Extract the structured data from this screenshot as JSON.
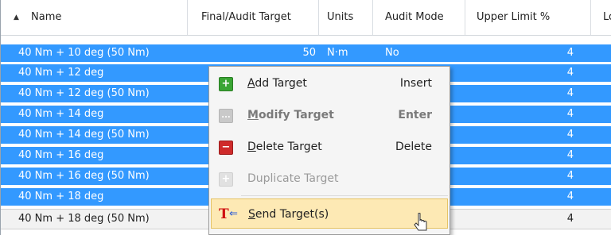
{
  "columns": [
    {
      "label": "Name"
    },
    {
      "label": "Final/Audit Target"
    },
    {
      "label": "Units"
    },
    {
      "label": "Audit Mode"
    },
    {
      "label": "Upper Limit %"
    },
    {
      "label": "Lo"
    }
  ],
  "rows": [
    {
      "name": "40 Nm + 10 deg (50 Nm)",
      "target": "50",
      "units": "N·m",
      "audit": "No",
      "upper": "4",
      "selected": true
    },
    {
      "name": "40 Nm + 12 deg",
      "target": "",
      "units": "",
      "audit": "",
      "upper": "4",
      "selected": true
    },
    {
      "name": "40 Nm + 12 deg (50 Nm)",
      "target": "",
      "units": "",
      "audit": "",
      "upper": "4",
      "selected": true
    },
    {
      "name": "40 Nm + 14 deg",
      "target": "",
      "units": "",
      "audit": "",
      "upper": "4",
      "selected": true
    },
    {
      "name": "40 Nm + 14 deg (50 Nm)",
      "target": "",
      "units": "",
      "audit": "",
      "upper": "4",
      "selected": true
    },
    {
      "name": "40 Nm + 16 deg",
      "target": "",
      "units": "",
      "audit": "",
      "upper": "4",
      "selected": true
    },
    {
      "name": "40 Nm + 16 deg (50 Nm)",
      "target": "",
      "units": "",
      "audit": "",
      "upper": "4",
      "selected": true
    },
    {
      "name": "40 Nm + 18 deg",
      "target": "",
      "units": "",
      "audit": "",
      "upper": "4",
      "selected": true
    },
    {
      "name": "40 Nm + 18 deg (50 Nm)",
      "target": "",
      "units": "",
      "audit": "",
      "upper": "4",
      "selected": false
    }
  ],
  "context_menu": {
    "add": {
      "label_pre": "",
      "accel": "A",
      "label_post": "dd Target",
      "shortcut": "Insert",
      "icon": "add-plus-icon"
    },
    "modify": {
      "label_pre": "",
      "accel": "M",
      "label_post": "odify Target",
      "shortcut": "Enter",
      "icon": "modify-ellipsis-icon"
    },
    "delete": {
      "label_pre": "",
      "accel": "D",
      "label_post": "elete Target",
      "shortcut": "Delete",
      "icon": "delete-minus-icon"
    },
    "duplicate": {
      "label": "Duplicate Target",
      "icon": "duplicate-plus-icon"
    },
    "send": {
      "label_pre": "",
      "accel": "S",
      "label_post": "end Target(s)",
      "icon": "send-target-icon",
      "glyph": "T",
      "arrow": "⇐"
    }
  },
  "colors": {
    "selection": "#3399ff",
    "menu_hover": "#fde9b4"
  }
}
